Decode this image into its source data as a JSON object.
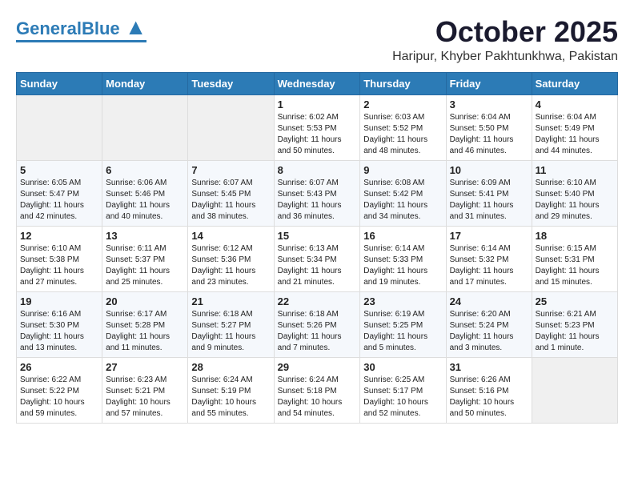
{
  "header": {
    "logo_general": "General",
    "logo_blue": "Blue",
    "month": "October 2025",
    "location": "Haripur, Khyber Pakhtunkhwa, Pakistan"
  },
  "weekdays": [
    "Sunday",
    "Monday",
    "Tuesday",
    "Wednesday",
    "Thursday",
    "Friday",
    "Saturday"
  ],
  "weeks": [
    [
      {
        "day": "",
        "sunrise": "",
        "sunset": "",
        "daylight": ""
      },
      {
        "day": "",
        "sunrise": "",
        "sunset": "",
        "daylight": ""
      },
      {
        "day": "",
        "sunrise": "",
        "sunset": "",
        "daylight": ""
      },
      {
        "day": "1",
        "sunrise": "Sunrise: 6:02 AM",
        "sunset": "Sunset: 5:53 PM",
        "daylight": "Daylight: 11 hours and 50 minutes."
      },
      {
        "day": "2",
        "sunrise": "Sunrise: 6:03 AM",
        "sunset": "Sunset: 5:52 PM",
        "daylight": "Daylight: 11 hours and 48 minutes."
      },
      {
        "day": "3",
        "sunrise": "Sunrise: 6:04 AM",
        "sunset": "Sunset: 5:50 PM",
        "daylight": "Daylight: 11 hours and 46 minutes."
      },
      {
        "day": "4",
        "sunrise": "Sunrise: 6:04 AM",
        "sunset": "Sunset: 5:49 PM",
        "daylight": "Daylight: 11 hours and 44 minutes."
      }
    ],
    [
      {
        "day": "5",
        "sunrise": "Sunrise: 6:05 AM",
        "sunset": "Sunset: 5:47 PM",
        "daylight": "Daylight: 11 hours and 42 minutes."
      },
      {
        "day": "6",
        "sunrise": "Sunrise: 6:06 AM",
        "sunset": "Sunset: 5:46 PM",
        "daylight": "Daylight: 11 hours and 40 minutes."
      },
      {
        "day": "7",
        "sunrise": "Sunrise: 6:07 AM",
        "sunset": "Sunset: 5:45 PM",
        "daylight": "Daylight: 11 hours and 38 minutes."
      },
      {
        "day": "8",
        "sunrise": "Sunrise: 6:07 AM",
        "sunset": "Sunset: 5:43 PM",
        "daylight": "Daylight: 11 hours and 36 minutes."
      },
      {
        "day": "9",
        "sunrise": "Sunrise: 6:08 AM",
        "sunset": "Sunset: 5:42 PM",
        "daylight": "Daylight: 11 hours and 34 minutes."
      },
      {
        "day": "10",
        "sunrise": "Sunrise: 6:09 AM",
        "sunset": "Sunset: 5:41 PM",
        "daylight": "Daylight: 11 hours and 31 minutes."
      },
      {
        "day": "11",
        "sunrise": "Sunrise: 6:10 AM",
        "sunset": "Sunset: 5:40 PM",
        "daylight": "Daylight: 11 hours and 29 minutes."
      }
    ],
    [
      {
        "day": "12",
        "sunrise": "Sunrise: 6:10 AM",
        "sunset": "Sunset: 5:38 PM",
        "daylight": "Daylight: 11 hours and 27 minutes."
      },
      {
        "day": "13",
        "sunrise": "Sunrise: 6:11 AM",
        "sunset": "Sunset: 5:37 PM",
        "daylight": "Daylight: 11 hours and 25 minutes."
      },
      {
        "day": "14",
        "sunrise": "Sunrise: 6:12 AM",
        "sunset": "Sunset: 5:36 PM",
        "daylight": "Daylight: 11 hours and 23 minutes."
      },
      {
        "day": "15",
        "sunrise": "Sunrise: 6:13 AM",
        "sunset": "Sunset: 5:34 PM",
        "daylight": "Daylight: 11 hours and 21 minutes."
      },
      {
        "day": "16",
        "sunrise": "Sunrise: 6:14 AM",
        "sunset": "Sunset: 5:33 PM",
        "daylight": "Daylight: 11 hours and 19 minutes."
      },
      {
        "day": "17",
        "sunrise": "Sunrise: 6:14 AM",
        "sunset": "Sunset: 5:32 PM",
        "daylight": "Daylight: 11 hours and 17 minutes."
      },
      {
        "day": "18",
        "sunrise": "Sunrise: 6:15 AM",
        "sunset": "Sunset: 5:31 PM",
        "daylight": "Daylight: 11 hours and 15 minutes."
      }
    ],
    [
      {
        "day": "19",
        "sunrise": "Sunrise: 6:16 AM",
        "sunset": "Sunset: 5:30 PM",
        "daylight": "Daylight: 11 hours and 13 minutes."
      },
      {
        "day": "20",
        "sunrise": "Sunrise: 6:17 AM",
        "sunset": "Sunset: 5:28 PM",
        "daylight": "Daylight: 11 hours and 11 minutes."
      },
      {
        "day": "21",
        "sunrise": "Sunrise: 6:18 AM",
        "sunset": "Sunset: 5:27 PM",
        "daylight": "Daylight: 11 hours and 9 minutes."
      },
      {
        "day": "22",
        "sunrise": "Sunrise: 6:18 AM",
        "sunset": "Sunset: 5:26 PM",
        "daylight": "Daylight: 11 hours and 7 minutes."
      },
      {
        "day": "23",
        "sunrise": "Sunrise: 6:19 AM",
        "sunset": "Sunset: 5:25 PM",
        "daylight": "Daylight: 11 hours and 5 minutes."
      },
      {
        "day": "24",
        "sunrise": "Sunrise: 6:20 AM",
        "sunset": "Sunset: 5:24 PM",
        "daylight": "Daylight: 11 hours and 3 minutes."
      },
      {
        "day": "25",
        "sunrise": "Sunrise: 6:21 AM",
        "sunset": "Sunset: 5:23 PM",
        "daylight": "Daylight: 11 hours and 1 minute."
      }
    ],
    [
      {
        "day": "26",
        "sunrise": "Sunrise: 6:22 AM",
        "sunset": "Sunset: 5:22 PM",
        "daylight": "Daylight: 10 hours and 59 minutes."
      },
      {
        "day": "27",
        "sunrise": "Sunrise: 6:23 AM",
        "sunset": "Sunset: 5:21 PM",
        "daylight": "Daylight: 10 hours and 57 minutes."
      },
      {
        "day": "28",
        "sunrise": "Sunrise: 6:24 AM",
        "sunset": "Sunset: 5:19 PM",
        "daylight": "Daylight: 10 hours and 55 minutes."
      },
      {
        "day": "29",
        "sunrise": "Sunrise: 6:24 AM",
        "sunset": "Sunset: 5:18 PM",
        "daylight": "Daylight: 10 hours and 54 minutes."
      },
      {
        "day": "30",
        "sunrise": "Sunrise: 6:25 AM",
        "sunset": "Sunset: 5:17 PM",
        "daylight": "Daylight: 10 hours and 52 minutes."
      },
      {
        "day": "31",
        "sunrise": "Sunrise: 6:26 AM",
        "sunset": "Sunset: 5:16 PM",
        "daylight": "Daylight: 10 hours and 50 minutes."
      },
      {
        "day": "",
        "sunrise": "",
        "sunset": "",
        "daylight": ""
      }
    ]
  ]
}
